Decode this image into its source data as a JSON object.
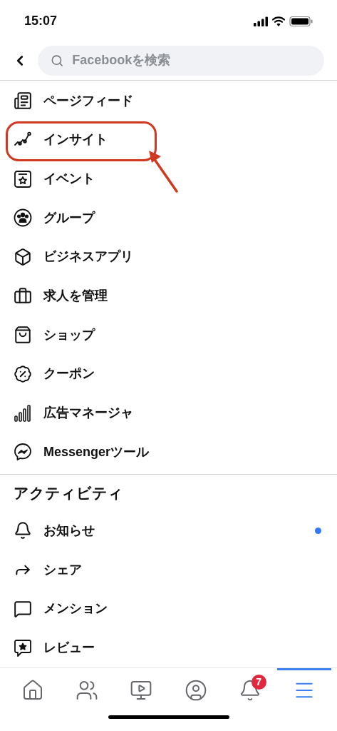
{
  "status_bar": {
    "time": "15:07"
  },
  "search": {
    "placeholder": "Facebookを検索"
  },
  "tools": [
    {
      "label": "ページフィード",
      "annotated": false
    },
    {
      "label": "インサイト",
      "annotated": true
    },
    {
      "label": "イベント",
      "annotated": false
    },
    {
      "label": "グループ",
      "annotated": false
    },
    {
      "label": "ビジネスアプリ",
      "annotated": false
    },
    {
      "label": "求人を管理",
      "annotated": false
    },
    {
      "label": "ショップ",
      "annotated": false
    },
    {
      "label": "クーポン",
      "annotated": false
    },
    {
      "label": "広告マネージャ",
      "annotated": false
    },
    {
      "label": "Messengerツール",
      "annotated": false
    }
  ],
  "activity": {
    "heading": "アクティビティ",
    "items": [
      {
        "label": "お知らせ",
        "unread": true
      },
      {
        "label": "シェア",
        "unread": false
      },
      {
        "label": "メンション",
        "unread": false
      },
      {
        "label": "レビュー",
        "unread": false
      }
    ]
  },
  "tab_bar": [
    {
      "selected": false
    },
    {
      "selected": false
    },
    {
      "selected": false
    },
    {
      "selected": false
    },
    {
      "selected": false,
      "badge": "7"
    },
    {
      "selected": true
    }
  ]
}
